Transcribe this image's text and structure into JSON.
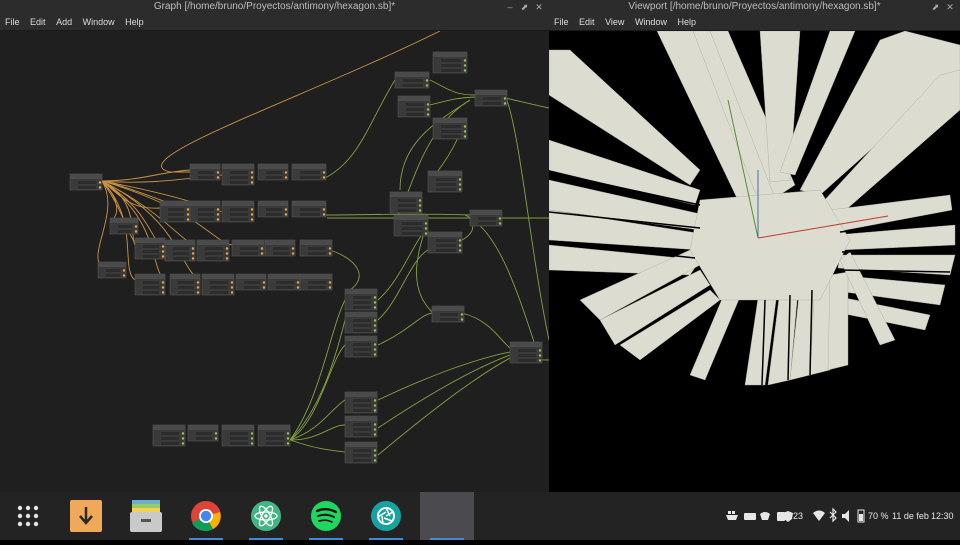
{
  "graph_window": {
    "title": "Graph [/home/bruno/Proyectos/antimony/hexagon.sb]*",
    "menu": [
      "File",
      "Edit",
      "Add",
      "Window",
      "Help"
    ],
    "controls": [
      "–",
      "⬈",
      "✕"
    ]
  },
  "viewport_window": {
    "title": "Viewport [/home/bruno/Proyectos/antimony/hexagon.sb]*",
    "menu": [
      "File",
      "Edit",
      "View",
      "Window",
      "Help"
    ],
    "controls": [
      "⬈",
      "✕"
    ]
  },
  "taskbar": {
    "apps": [
      {
        "name": "app-grid",
        "icon": "app-grid-icon"
      },
      {
        "name": "downloader",
        "icon": "download-icon"
      },
      {
        "name": "files",
        "icon": "file-cabinet-icon"
      },
      {
        "name": "chrome",
        "icon": "chrome-icon"
      },
      {
        "name": "atom",
        "icon": "atom-icon"
      },
      {
        "name": "spotify",
        "icon": "spotify-icon"
      },
      {
        "name": "camera",
        "icon": "aperture-icon"
      },
      {
        "name": "active-window",
        "icon": ""
      }
    ],
    "tray": {
      "notifications": "23",
      "battery": "70 %",
      "date": "11 de feb",
      "time": "12:30"
    },
    "colors": {
      "accent": "#3c8cd6",
      "background": "#232323"
    }
  },
  "colors": {
    "orange_wire": "#e8a84a",
    "green_wire": "#9bc24d",
    "mesh": "#dcdcd0",
    "axis_x": "#c0392b",
    "axis_y": "#5b8c3a",
    "axis_z": "#4a6f9c"
  }
}
